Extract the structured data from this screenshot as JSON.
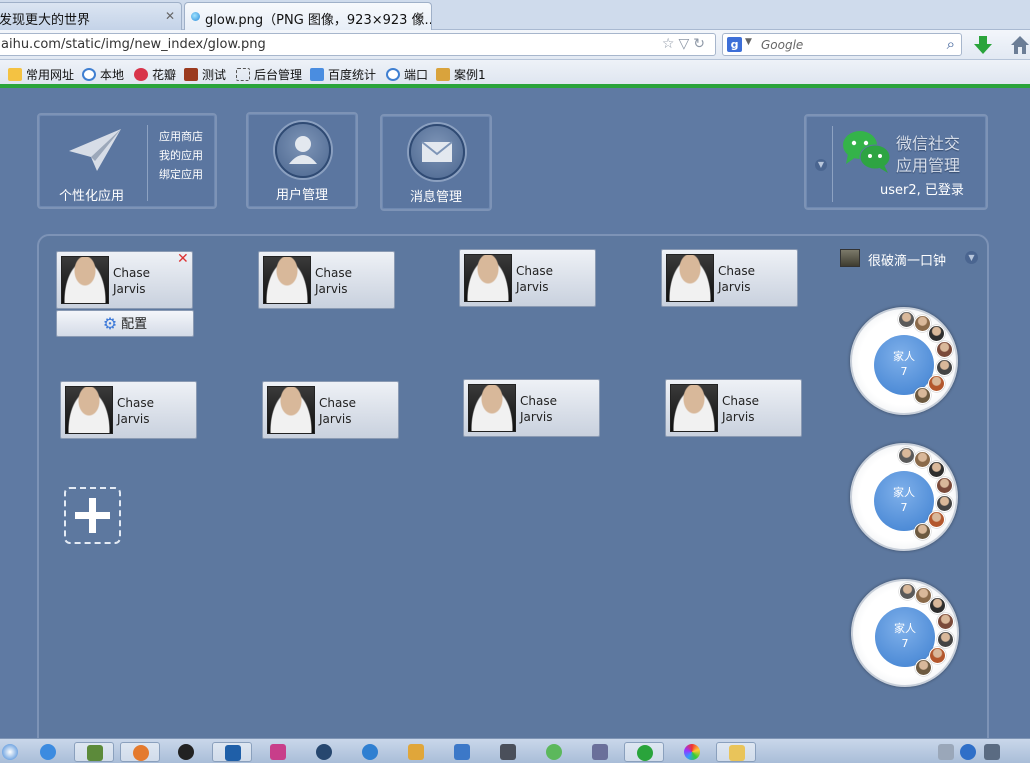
{
  "browser": {
    "tabs": [
      {
        "label": "发现更大的世界",
        "active": false
      },
      {
        "label": "glow.png（PNG 图像，923×923 像...",
        "active": true
      }
    ],
    "url": "aihu.com/static/img/new_index/glow.png",
    "search_placeholder": "Google",
    "bookmarks": [
      "常用网址",
      "本地",
      "花瓣",
      "测试",
      "后台管理",
      "百度统计",
      "端口",
      "案例1"
    ]
  },
  "top_nav": {
    "app_tile": {
      "label": "个性化应用",
      "links": [
        "应用商店",
        "我的应用",
        "绑定应用"
      ]
    },
    "user_tile": {
      "label": "用户管理"
    },
    "msg_tile": {
      "label": "消息管理"
    },
    "wechat_tile": {
      "title_line1": "微信社交",
      "title_line2": "应用管理",
      "status": "user2, 已登录"
    }
  },
  "contacts": [
    {
      "first": "Chase",
      "last": "Jarvis"
    },
    {
      "first": "Chase",
      "last": "Jarvis"
    },
    {
      "first": "Chase",
      "last": "Jarvis"
    },
    {
      "first": "Chase",
      "last": "Jarvis"
    },
    {
      "first": "Chase",
      "last": "Jarvis"
    },
    {
      "first": "Chase",
      "last": "Jarvis"
    },
    {
      "first": "Chase",
      "last": "Jarvis"
    },
    {
      "first": "Chase",
      "last": "Jarvis"
    }
  ],
  "config_button": "配置",
  "group_panel": {
    "name": "很破滴一口钟",
    "groups": [
      {
        "label": "家人",
        "count": "7"
      },
      {
        "label": "家人",
        "count": "7"
      },
      {
        "label": "家人",
        "count": "7"
      }
    ]
  },
  "colors": {
    "accent_green": "#2aa43b",
    "page_bg": "#5f7aa3",
    "group_core": "#3d7fd0",
    "close_red": "#d33333"
  }
}
